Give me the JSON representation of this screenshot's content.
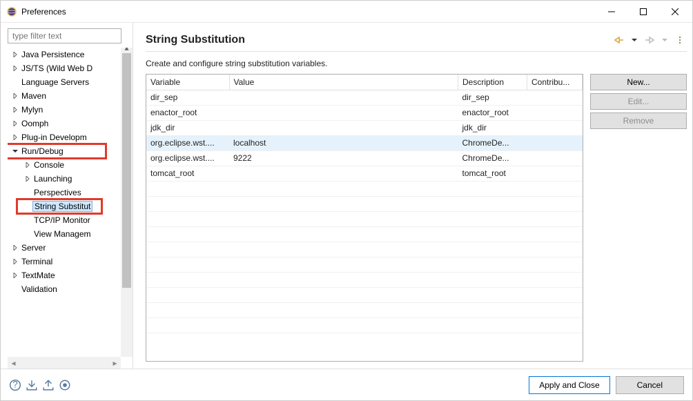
{
  "window": {
    "title": "Preferences"
  },
  "sidebar": {
    "filter_placeholder": "type filter text",
    "items": [
      {
        "label": "Java Persistence",
        "level": 0,
        "expand": "right",
        "selected": false
      },
      {
        "label": "JS/TS (Wild Web D",
        "level": 0,
        "expand": "right",
        "selected": false
      },
      {
        "label": "Language Servers",
        "level": 0,
        "expand": "none",
        "selected": false
      },
      {
        "label": "Maven",
        "level": 0,
        "expand": "right",
        "selected": false
      },
      {
        "label": "Mylyn",
        "level": 0,
        "expand": "right",
        "selected": false
      },
      {
        "label": "Oomph",
        "level": 0,
        "expand": "right",
        "selected": false
      },
      {
        "label": "Plug-in Developm",
        "level": 0,
        "expand": "right",
        "selected": false
      },
      {
        "label": "Run/Debug",
        "level": 0,
        "expand": "down",
        "selected": false,
        "highlight": true
      },
      {
        "label": "Console",
        "level": 1,
        "expand": "right",
        "selected": false
      },
      {
        "label": "Launching",
        "level": 1,
        "expand": "right",
        "selected": false
      },
      {
        "label": "Perspectives",
        "level": 1,
        "expand": "none",
        "selected": false
      },
      {
        "label": "String Substitut",
        "level": 1,
        "expand": "none",
        "selected": true,
        "highlight": true
      },
      {
        "label": "TCP/IP Monitor",
        "level": 1,
        "expand": "none",
        "selected": false
      },
      {
        "label": "View Managem",
        "level": 1,
        "expand": "none",
        "selected": false
      },
      {
        "label": "Server",
        "level": 0,
        "expand": "right",
        "selected": false
      },
      {
        "label": "Terminal",
        "level": 0,
        "expand": "right",
        "selected": false
      },
      {
        "label": "TextMate",
        "level": 0,
        "expand": "right",
        "selected": false
      },
      {
        "label": "Validation",
        "level": 0,
        "expand": "none",
        "selected": false
      }
    ]
  },
  "content": {
    "title": "String Substitution",
    "description": "Create and configure string substitution variables.",
    "columns": [
      "Variable",
      "Value",
      "Description",
      "Contribu..."
    ],
    "rows": [
      {
        "variable": "dir_sep",
        "value": "",
        "description": "dir_sep",
        "contributed": "",
        "selected": false
      },
      {
        "variable": "enactor_root",
        "value": "",
        "description": "enactor_root",
        "contributed": "",
        "selected": false
      },
      {
        "variable": "jdk_dir",
        "value": "",
        "description": "jdk_dir",
        "contributed": "",
        "selected": false
      },
      {
        "variable": "org.eclipse.wst....",
        "value": "localhost",
        "description": "ChromeDe...",
        "contributed": "",
        "selected": true
      },
      {
        "variable": "org.eclipse.wst....",
        "value": "9222",
        "description": "ChromeDe...",
        "contributed": "",
        "selected": false
      },
      {
        "variable": "tomcat_root",
        "value": "",
        "description": "tomcat_root",
        "contributed": "",
        "selected": false
      }
    ],
    "buttons": {
      "new": "New...",
      "edit": "Edit...",
      "remove": "Remove"
    }
  },
  "footer": {
    "apply": "Apply and Close",
    "cancel": "Cancel"
  }
}
